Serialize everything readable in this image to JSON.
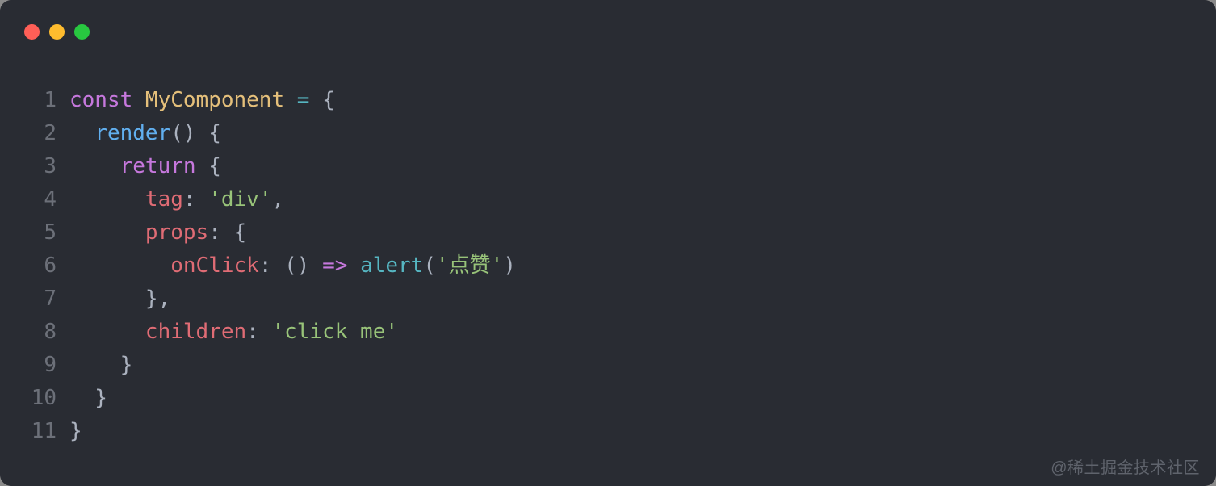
{
  "traffic_lights": [
    "red",
    "yellow",
    "green"
  ],
  "watermark": "@稀土掘金技术社区",
  "code": {
    "lines": [
      {
        "n": "1",
        "tokens": [
          {
            "t": "const ",
            "c": "kw"
          },
          {
            "t": "MyComponent",
            "c": "cls"
          },
          {
            "t": " ",
            "c": "punct"
          },
          {
            "t": "=",
            "c": "op"
          },
          {
            "t": " {",
            "c": "punct"
          }
        ]
      },
      {
        "n": "2",
        "tokens": [
          {
            "t": "  ",
            "c": "punct"
          },
          {
            "t": "render",
            "c": "fn"
          },
          {
            "t": "() {",
            "c": "punct"
          }
        ]
      },
      {
        "n": "3",
        "tokens": [
          {
            "t": "    ",
            "c": "punct"
          },
          {
            "t": "return",
            "c": "kw"
          },
          {
            "t": " {",
            "c": "punct"
          }
        ]
      },
      {
        "n": "4",
        "tokens": [
          {
            "t": "      ",
            "c": "punct"
          },
          {
            "t": "tag",
            "c": "prop"
          },
          {
            "t": ": ",
            "c": "punct"
          },
          {
            "t": "'div'",
            "c": "str"
          },
          {
            "t": ",",
            "c": "punct"
          }
        ]
      },
      {
        "n": "5",
        "tokens": [
          {
            "t": "      ",
            "c": "punct"
          },
          {
            "t": "props",
            "c": "prop"
          },
          {
            "t": ": {",
            "c": "punct"
          }
        ]
      },
      {
        "n": "6",
        "tokens": [
          {
            "t": "        ",
            "c": "punct"
          },
          {
            "t": "onClick",
            "c": "prop"
          },
          {
            "t": ": () ",
            "c": "punct"
          },
          {
            "t": "=>",
            "c": "arrow"
          },
          {
            "t": " ",
            "c": "punct"
          },
          {
            "t": "alert",
            "c": "call"
          },
          {
            "t": "(",
            "c": "punct"
          },
          {
            "t": "'点赞'",
            "c": "str"
          },
          {
            "t": ")",
            "c": "punct"
          }
        ]
      },
      {
        "n": "7",
        "tokens": [
          {
            "t": "      },",
            "c": "punct"
          }
        ]
      },
      {
        "n": "8",
        "tokens": [
          {
            "t": "      ",
            "c": "punct"
          },
          {
            "t": "children",
            "c": "prop"
          },
          {
            "t": ": ",
            "c": "punct"
          },
          {
            "t": "'click me'",
            "c": "str"
          }
        ]
      },
      {
        "n": "9",
        "tokens": [
          {
            "t": "    }",
            "c": "punct"
          }
        ]
      },
      {
        "n": "10",
        "tokens": [
          {
            "t": "  }",
            "c": "punct"
          }
        ]
      },
      {
        "n": "11",
        "tokens": [
          {
            "t": "}",
            "c": "punct"
          }
        ]
      }
    ]
  }
}
